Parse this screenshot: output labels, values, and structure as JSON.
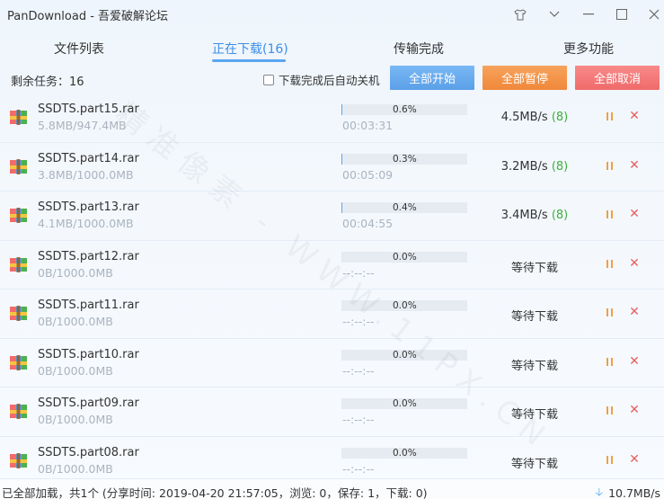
{
  "window": {
    "title": "PanDownload - 吾爱破解论坛",
    "buttons": {
      "skin": "⚐",
      "dropdown": "⌄",
      "minimize": "—",
      "maximize": "☐",
      "close": "✕"
    }
  },
  "tabs": [
    {
      "label": "文件列表"
    },
    {
      "label": "正在下载(16)"
    },
    {
      "label": "传输完成"
    },
    {
      "label": "更多功能"
    }
  ],
  "toolbar": {
    "remaining": "剩余任务：16",
    "auto_shutdown": "下载完成后自动关机",
    "start_all": "全部开始",
    "pause_all": "全部暂停",
    "cancel_all": "全部取消"
  },
  "colors": {
    "accent": "#5aa6f0",
    "pause": "#f0a040",
    "cancel": "#e86060",
    "speed_green": "#3cb03c"
  },
  "downloads": [
    {
      "name": "SSDTS.part15.rar",
      "size": "5.8MB/947.4MB",
      "progress": 0.6,
      "progress_text": "0.6%",
      "time": "00:03:31",
      "speed": "4.5MB/s",
      "threads": "(8)",
      "status": ""
    },
    {
      "name": "SSDTS.part14.rar",
      "size": "3.8MB/1000.0MB",
      "progress": 0.3,
      "progress_text": "0.3%",
      "time": "00:05:09",
      "speed": "3.2MB/s",
      "threads": "(8)",
      "status": ""
    },
    {
      "name": "SSDTS.part13.rar",
      "size": "4.1MB/1000.0MB",
      "progress": 0.4,
      "progress_text": "0.4%",
      "time": "00:04:55",
      "speed": "3.4MB/s",
      "threads": "(8)",
      "status": ""
    },
    {
      "name": "SSDTS.part12.rar",
      "size": "0B/1000.0MB",
      "progress": 0.0,
      "progress_text": "0.0%",
      "time": "--:--:--",
      "speed": "",
      "threads": "",
      "status": "等待下载"
    },
    {
      "name": "SSDTS.part11.rar",
      "size": "0B/1000.0MB",
      "progress": 0.0,
      "progress_text": "0.0%",
      "time": "--:--:--",
      "speed": "",
      "threads": "",
      "status": "等待下载"
    },
    {
      "name": "SSDTS.part10.rar",
      "size": "0B/1000.0MB",
      "progress": 0.0,
      "progress_text": "0.0%",
      "time": "--:--:--",
      "speed": "",
      "threads": "",
      "status": "等待下载"
    },
    {
      "name": "SSDTS.part09.rar",
      "size": "0B/1000.0MB",
      "progress": 0.0,
      "progress_text": "0.0%",
      "time": "--:--:--",
      "speed": "",
      "threads": "",
      "status": "等待下载"
    },
    {
      "name": "SSDTS.part08.rar",
      "size": "0B/1000.0MB",
      "progress": 0.0,
      "progress_text": "0.0%",
      "time": "--:--:--",
      "speed": "",
      "threads": "",
      "status": "等待下载"
    }
  ],
  "statusbar": {
    "text": "已全部加载，共1个 (分享时间: 2019-04-20 21:57:05，浏览: 0，保存: 1，下载: 0)",
    "download_speed": "10.7MB/s"
  },
  "watermark": "精准像素 - WWW.11PX.CN"
}
